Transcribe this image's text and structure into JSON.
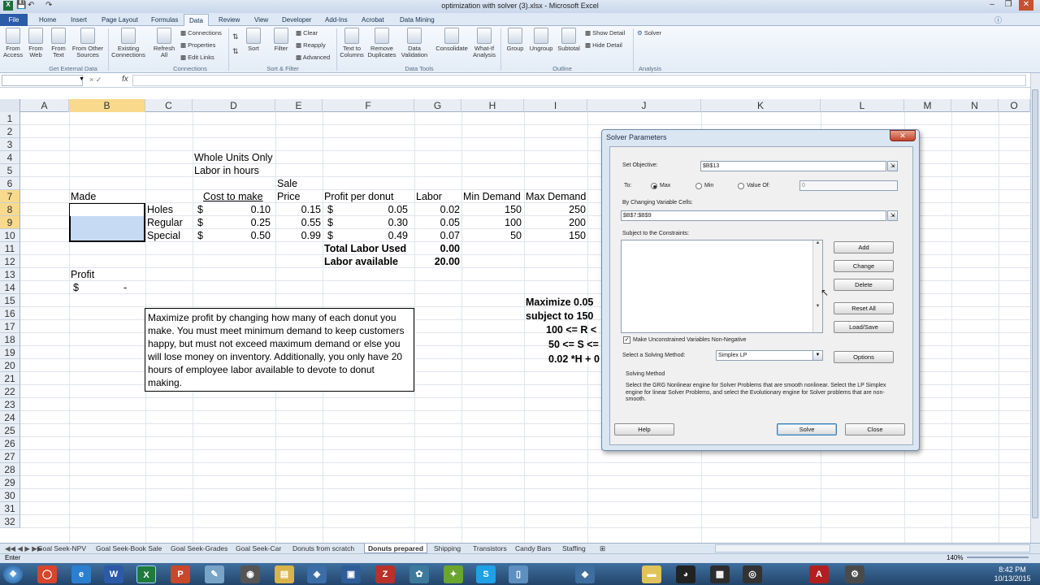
{
  "window": {
    "title": "optimization with solver (3).xlsx - Microsoft Excel"
  },
  "ribbon": {
    "tabs": [
      "File",
      "Home",
      "Insert",
      "Page Layout",
      "Formulas",
      "Data",
      "Review",
      "View",
      "Developer",
      "Add-Ins",
      "Acrobat",
      "Data Mining"
    ],
    "active_tab": "Data",
    "buttons": {
      "from_access": "From Access",
      "from_web": "From Web",
      "from_text": "From Text",
      "from_other": "From Other Sources",
      "existing": "Existing Connections",
      "refresh": "Refresh All",
      "connections": "Connections",
      "properties": "Properties",
      "edit_links": "Edit Links",
      "sort": "Sort",
      "filter": "Filter",
      "clear": "Clear",
      "reapply": "Reapply",
      "advanced": "Advanced",
      "text_to_columns": "Text to Columns",
      "remove_duplicates": "Remove Duplicates",
      "data_validation": "Data Validation",
      "consolidate": "Consolidate",
      "what_if": "What-If Analysis",
      "group": "Group",
      "ungroup": "Ungroup",
      "subtotal": "Subtotal",
      "show_detail": "Show Detail",
      "hide_detail": "Hide Detail",
      "solver": "Solver"
    },
    "groups": {
      "external": "Get External Data",
      "connections": "Connections",
      "sort_filter": "Sort & Filter",
      "data_tools": "Data Tools",
      "outline": "Outline",
      "analysis": "Analysis"
    }
  },
  "formula_bar": {
    "fx": "fx",
    "cancel_enter": "× ✓"
  },
  "columns": [
    "A",
    "B",
    "C",
    "D",
    "E",
    "F",
    "G",
    "H",
    "I",
    "J",
    "K",
    "L",
    "M",
    "N",
    "O"
  ],
  "rows": [
    "1",
    "2",
    "3",
    "4",
    "5",
    "6",
    "7",
    "8",
    "9",
    "10",
    "11",
    "12",
    "13",
    "14",
    "15",
    "16",
    "17",
    "18",
    "19",
    "20",
    "21",
    "22",
    "23",
    "24",
    "25",
    "26",
    "27",
    "28",
    "29",
    "30",
    "31",
    "32"
  ],
  "cells": {
    "c4": "Whole Units Only",
    "c5": "Labor in hours",
    "sale": "Sale",
    "price": "Price",
    "made": "Made",
    "cost_to_make": "Cost to make",
    "profit_per_donut": "Profit per donut",
    "labor": "Labor",
    "min_demand": "Min Demand",
    "max_demand": "Max Demand",
    "items": [
      {
        "name": "Holes",
        "cost": "0.10",
        "price": "0.15",
        "profit": "0.05",
        "labor": "0.02",
        "min": "150",
        "max": "250"
      },
      {
        "name": "Regular",
        "cost": "0.25",
        "price": "0.55",
        "profit": "0.30",
        "labor": "0.05",
        "min": "100",
        "max": "200"
      },
      {
        "name": "Special",
        "cost": "0.50",
        "price": "0.99",
        "profit": "0.49",
        "labor": "0.07",
        "min": "50",
        "max": "150"
      }
    ],
    "currency": "$",
    "total_labor_used": "Total Labor Used",
    "total_labor_val": "0.00",
    "labor_available": "Labor available",
    "labor_available_val": "20.00",
    "profit": "Profit",
    "profit_dollar": "$",
    "profit_val": "-",
    "note": "Maximize profit by changing how many of each donut you make. You must meet minimum demand to keep customers happy, but must not exceed maximum demand or else you will lose money on inventory. Additionally, you only have 20 hours of employee labor available to devote to donut making.",
    "j14": "Maximize 0.05",
    "j15": "subject to  150",
    "j16": "100 <= R <",
    "j17": "50 <= S <=",
    "j18": "0.02 *H + 0"
  },
  "sheets": [
    "Goal Seek-NPV",
    "Goal Seek-Book Sale",
    "Goal Seek-Grades",
    "Goal Seek-Car",
    "Donuts from scratch",
    "Donuts prepared",
    "Shipping",
    "Transistors",
    "Candy Bars",
    "Staffing"
  ],
  "active_sheet": "Donuts prepared",
  "status": {
    "mode": "Enter",
    "zoom": "140%"
  },
  "clock": {
    "time": "8:42 PM",
    "date": "10/13/2015"
  },
  "dialog": {
    "title": "Solver Parameters",
    "close": "✕",
    "set_objective_label": "Set Objective:",
    "set_objective_value": "$B$13",
    "to_label": "To:",
    "max": "Max",
    "min": "Min",
    "value_of": "Value Of:",
    "value_of_value": "0",
    "changing_label": "By Changing Variable Cells:",
    "changing_value": "$B$7:$B$9",
    "constraints_label": "Subject to the Constraints:",
    "add": "Add",
    "change": "Change",
    "delete": "Delete",
    "reset_all": "Reset All",
    "load_save": "Load/Save",
    "nonneg": "Make Unconstrained Variables Non-Negative",
    "method_label": "Select a Solving Method:",
    "method_value": "Simplex LP",
    "options": "Options",
    "solving_method_title": "Solving Method",
    "solving_method_text": "Select the GRG Nonlinear engine for Solver Problems that are smooth nonlinear. Select the LP Simplex engine for linear Solver Problems, and select the Evolutionary engine for Solver problems that are non-smooth.",
    "help": "Help",
    "solve": "Solve",
    "close_btn": "Close"
  }
}
